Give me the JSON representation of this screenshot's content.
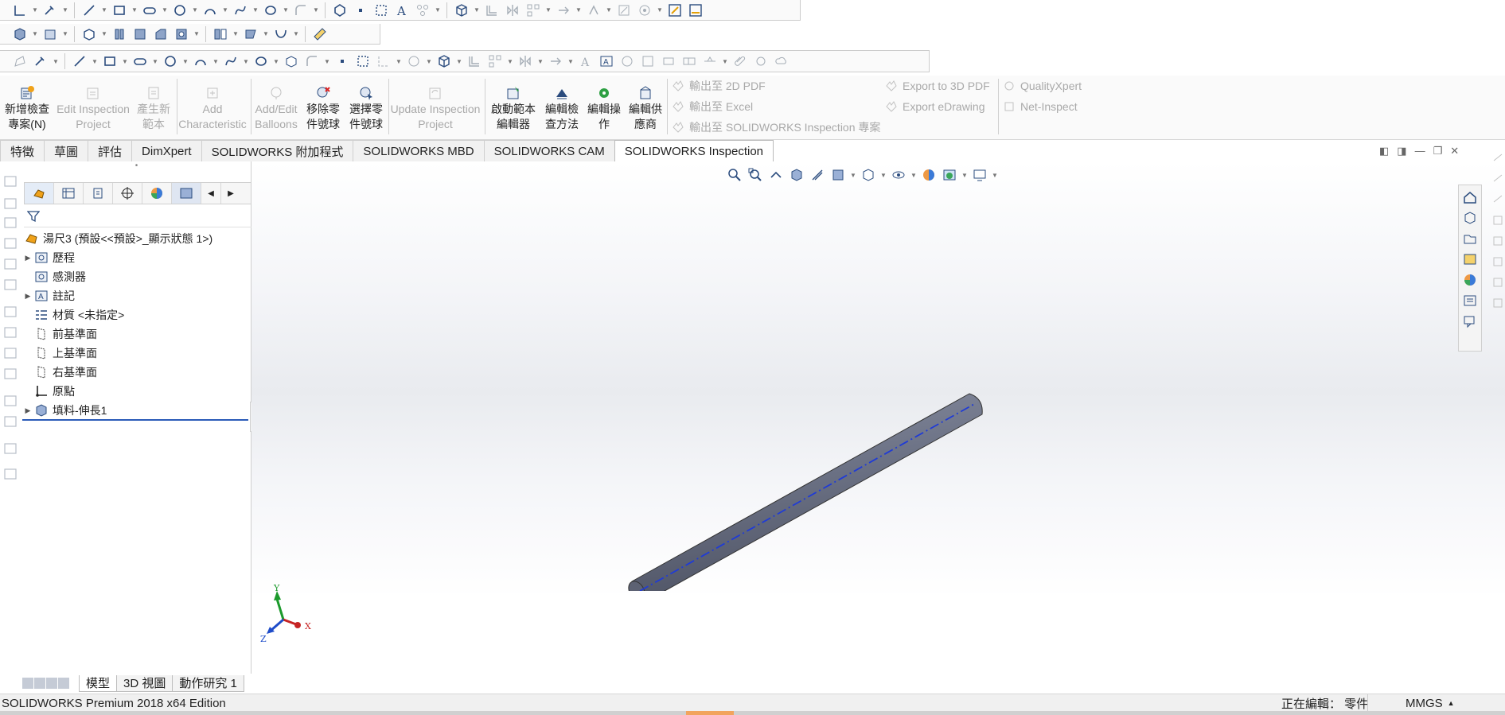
{
  "ribbon": {
    "new_project": [
      "新增檢查",
      "專案(N)"
    ],
    "edit_project": [
      "Edit Inspection",
      "Project"
    ],
    "generate_template": [
      "產生新",
      "範本"
    ],
    "add_characteristic": [
      "Add",
      "Characteristic"
    ],
    "add_edit_balloons": [
      "Add/Edit",
      "Balloons"
    ],
    "remove_balloon": [
      "移除零",
      "件號球"
    ],
    "select_balloon": [
      "選擇零",
      "件號球"
    ],
    "update_project": [
      "Update Inspection",
      "Project"
    ],
    "launch_template_editor": [
      "啟動範本",
      "編輯器"
    ],
    "edit_method": [
      "編輯檢",
      "查方法"
    ],
    "edit_operation": [
      "編輯操",
      "作"
    ],
    "edit_vendor": [
      "編輯供",
      "應商"
    ],
    "export_2d_pdf": "輸出至 2D PDF",
    "export_excel": "輸出至 Excel",
    "export_sw_project": "輸出至 SOLIDWORKS Inspection 專案",
    "export_3d_pdf": "Export to 3D PDF",
    "export_edrawing": "Export eDrawing",
    "quality_xpert": "QualityXpert",
    "net_inspect": "Net-Inspect"
  },
  "command_tabs": [
    {
      "label": "特徵",
      "active": false
    },
    {
      "label": "草圖",
      "active": false
    },
    {
      "label": "評估",
      "active": false
    },
    {
      "label": "DimXpert",
      "active": false
    },
    {
      "label": "SOLIDWORKS 附加程式",
      "active": false
    },
    {
      "label": "SOLIDWORKS MBD",
      "active": false
    },
    {
      "label": "SOLIDWORKS CAM",
      "active": false
    },
    {
      "label": "SOLIDWORKS Inspection",
      "active": true
    }
  ],
  "feature_tree": {
    "root": "湯尺3 (預設<<預設>_顯示狀態 1>)",
    "items": [
      {
        "label": "歷程",
        "expandable": true,
        "icon": "history-icon"
      },
      {
        "label": "感測器",
        "expandable": false,
        "icon": "sensor-icon"
      },
      {
        "label": "註記",
        "expandable": true,
        "icon": "annotation-icon"
      },
      {
        "label": "材質 <未指定>",
        "expandable": false,
        "icon": "material-icon"
      },
      {
        "label": "前基準面",
        "expandable": false,
        "icon": "plane-icon"
      },
      {
        "label": "上基準面",
        "expandable": false,
        "icon": "plane-icon"
      },
      {
        "label": "右基準面",
        "expandable": false,
        "icon": "plane-icon"
      },
      {
        "label": "原點",
        "expandable": false,
        "icon": "origin-icon"
      },
      {
        "label": "填料-伸長1",
        "expandable": true,
        "icon": "extrude-icon"
      }
    ]
  },
  "triad": {
    "x": "X",
    "y": "Y",
    "z": "Z"
  },
  "bottom_tabs": [
    {
      "label": "模型",
      "active": true
    },
    {
      "label": "3D 視圖",
      "active": false
    },
    {
      "label": "動作研究 1",
      "active": false
    }
  ],
  "status": {
    "edition": "SOLIDWORKS Premium 2018 x64 Edition",
    "editing": "正在編輯： 零件",
    "units": "MMGS"
  },
  "colors": {
    "accent_blue": "#2b4c7e",
    "part_gray": "#6e7487",
    "centerline_blue": "#1f3bd6"
  }
}
